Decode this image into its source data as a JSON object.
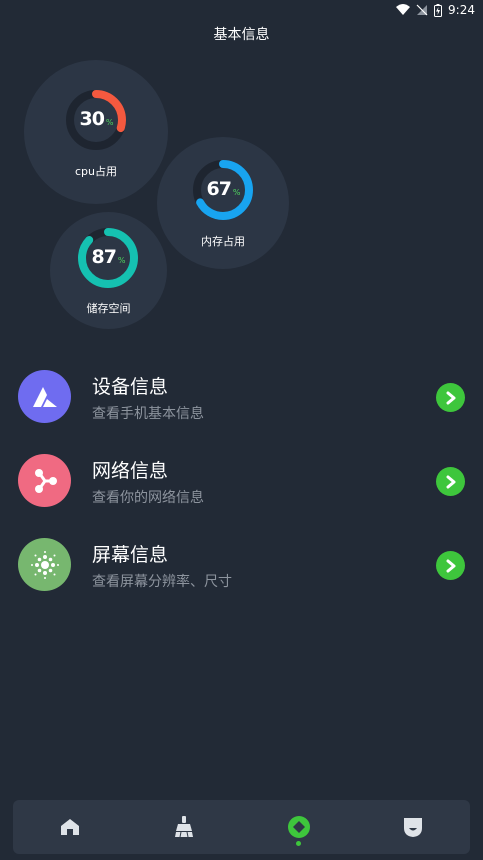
{
  "status_bar": {
    "time": "9:24"
  },
  "page": {
    "title": "基本信息"
  },
  "gauges": [
    {
      "id": "cpu",
      "value": "30",
      "percent": 30,
      "unit": "%",
      "label": "cpu占用",
      "color": "#f4593f"
    },
    {
      "id": "memory",
      "value": "67",
      "percent": 67,
      "unit": "%",
      "label": "内存占用",
      "color": "#18a4f0"
    },
    {
      "id": "storage",
      "value": "87",
      "percent": 87,
      "unit": "%",
      "label": "储存空间",
      "color": "#15c1b1"
    }
  ],
  "info_items": [
    {
      "title": "设备信息",
      "subtitle": "查看手机基本信息",
      "icon": "device-icon",
      "color": "#6f6cf0"
    },
    {
      "title": "网络信息",
      "subtitle": "查看你的网络信息",
      "icon": "network-icon",
      "color": "#f06a82"
    },
    {
      "title": "屏幕信息",
      "subtitle": "查看屏幕分辨率、尺寸",
      "icon": "screen-icon",
      "color": "#77b76f"
    }
  ],
  "bottom_nav": [
    {
      "icon": "home-icon",
      "active": false
    },
    {
      "icon": "broom-icon",
      "active": false
    },
    {
      "icon": "info-diamond-icon",
      "active": true
    },
    {
      "icon": "shield-icon",
      "active": false
    }
  ],
  "colors": {
    "background": "#222a36",
    "card": "#2c3645",
    "accent": "#3ec63c",
    "track": "#1e2530"
  }
}
